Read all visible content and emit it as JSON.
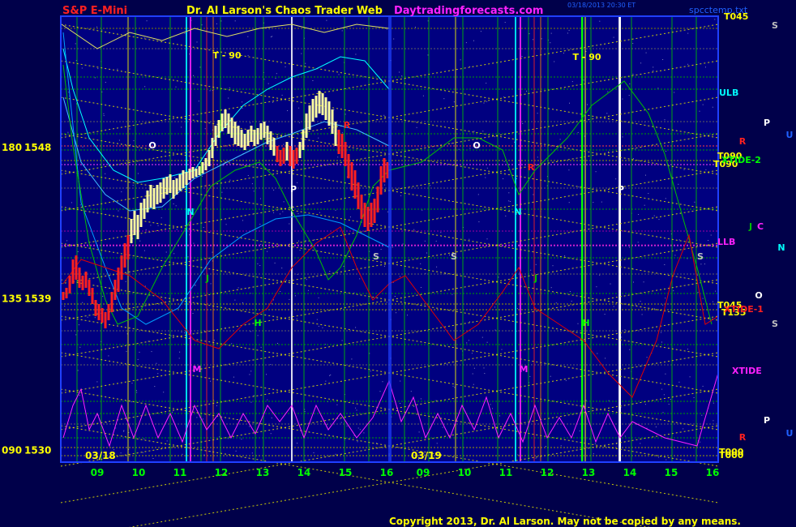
{
  "header": {
    "symbol": "S&P E-Mini",
    "site_title": "Dr. Al Larson's Chaos Trader Web",
    "site_url": "Daytradingforecasts.com",
    "timestamp": "03/18/2013 20:30 ET",
    "filename": "spcctemp.txt"
  },
  "footer": {
    "copyright": "Copyright 2013, Dr. Al Larson. May not be copied by any means."
  },
  "colors": {
    "background": "#00004a",
    "plot_background": "#000080",
    "title_red": "#ff2020",
    "title_yellow": "#ffff00",
    "url_magenta": "#ff20ff",
    "copyright_yellow": "#ffff00"
  },
  "chart_data": {
    "type": "line",
    "y_labels": [
      {
        "angle": "180",
        "price": "1548",
        "value": 1548
      },
      {
        "angle": "135",
        "price": "1539",
        "value": 1539
      },
      {
        "angle": "090",
        "price": "1530",
        "value": 1530
      }
    ],
    "ylim": [
      1529.3,
      1555.8
    ],
    "days": [
      {
        "date": "03/18",
        "hours": [
          "09",
          "10",
          "11",
          "12",
          "13",
          "14",
          "15",
          "16"
        ]
      },
      {
        "date": "03/19",
        "hours": [
          "09",
          "10",
          "11",
          "12",
          "13",
          "14",
          "15",
          "16"
        ]
      }
    ],
    "right_labels": [
      {
        "text": "T045",
        "color": "#ffff00"
      },
      {
        "text": "ULB",
        "color": "#00ffff"
      },
      {
        "text": "T090",
        "color": "#ffff00"
      },
      {
        "text": "T090",
        "color": "#ffff00"
      },
      {
        "text": "XTIDE-2",
        "color": "#00ff00"
      },
      {
        "text": "LLB",
        "color": "#ff20ff"
      },
      {
        "text": "T045",
        "color": "#ffff00"
      },
      {
        "text": "T135",
        "color": "#ffff00"
      },
      {
        "text": "XTIDE-1",
        "color": "#ff2020"
      },
      {
        "text": "XTIDE",
        "color": "#ff20ff"
      },
      {
        "text": "T000",
        "color": "#ffff00"
      },
      {
        "text": "T000",
        "color": "#ffff00"
      }
    ],
    "plot_markers": [
      {
        "text": "T - 90",
        "color": "#ffff00"
      },
      {
        "text": "T - 90",
        "color": "#ffff00"
      },
      {
        "text": "O",
        "color": "#ffffff"
      },
      {
        "text": "O",
        "color": "#ffffff"
      },
      {
        "text": "N",
        "color": "#00ffff"
      },
      {
        "text": "N",
        "color": "#00ffff"
      },
      {
        "text": "P",
        "color": "#ffffff"
      },
      {
        "text": "P",
        "color": "#ffffff"
      },
      {
        "text": "S",
        "color": "#c0c0c0"
      },
      {
        "text": "S",
        "color": "#c0c0c0"
      },
      {
        "text": "S",
        "color": "#c0c0c0"
      },
      {
        "text": "J",
        "color": "#00c000"
      },
      {
        "text": "J",
        "color": "#00c000"
      },
      {
        "text": "H",
        "color": "#00ff00"
      },
      {
        "text": "H",
        "color": "#00ff00"
      },
      {
        "text": "M",
        "color": "#ff20ff"
      },
      {
        "text": "M",
        "color": "#ff20ff"
      },
      {
        "text": "R",
        "color": "#ff2020"
      },
      {
        "text": "R",
        "color": "#ff2020"
      }
    ],
    "margin_markers": [
      {
        "text": "S",
        "color": "#c0c0c0"
      },
      {
        "text": "R",
        "color": "#ff2020"
      },
      {
        "text": "P",
        "color": "#ffffff"
      },
      {
        "text": "U",
        "color": "#2060ff"
      },
      {
        "text": "J",
        "color": "#00c000"
      },
      {
        "text": "C",
        "color": "#ff20ff"
      },
      {
        "text": "N",
        "color": "#00ffff"
      },
      {
        "text": "O",
        "color": "#ffffff"
      },
      {
        "text": "S",
        "color": "#c0c0c0"
      },
      {
        "text": "P",
        "color": "#ffffff"
      },
      {
        "text": "R",
        "color": "#ff2020"
      },
      {
        "text": "U",
        "color": "#2060ff"
      }
    ]
  }
}
